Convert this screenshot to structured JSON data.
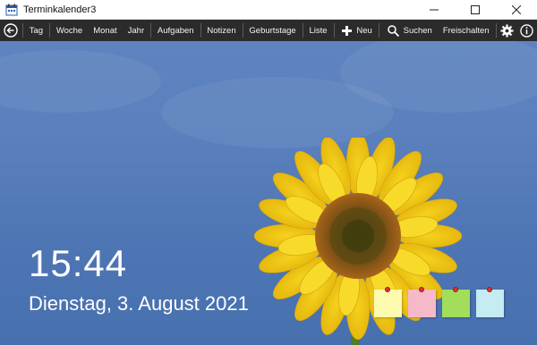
{
  "window": {
    "title": "Terminkalender3",
    "controls": [
      "minimize",
      "maximize",
      "close"
    ]
  },
  "toolbar": {
    "back_icon": "back-circle-icon",
    "items": [
      {
        "label": "Tag"
      },
      {
        "label": "Woche"
      },
      {
        "label": "Monat"
      },
      {
        "label": "Jahr"
      },
      {
        "label": "Aufgaben"
      },
      {
        "label": "Notizen"
      },
      {
        "label": "Geburtstage"
      },
      {
        "label": "Liste"
      }
    ],
    "new_label": "Neu",
    "search_label": "Suchen",
    "unlock_label": "Freischalten",
    "settings_icon": "gear-icon",
    "info_icon": "info-icon"
  },
  "clock": {
    "time": "15:44",
    "date": "Dienstag, 3. August 2021"
  },
  "notes": {
    "colors": [
      "#fdfbb0",
      "#f6b9c9",
      "#a3dd5c",
      "#c5ecf2"
    ]
  },
  "colors": {
    "toolbar_bg": "#2b2b2b",
    "sky": "#5a80bd"
  }
}
